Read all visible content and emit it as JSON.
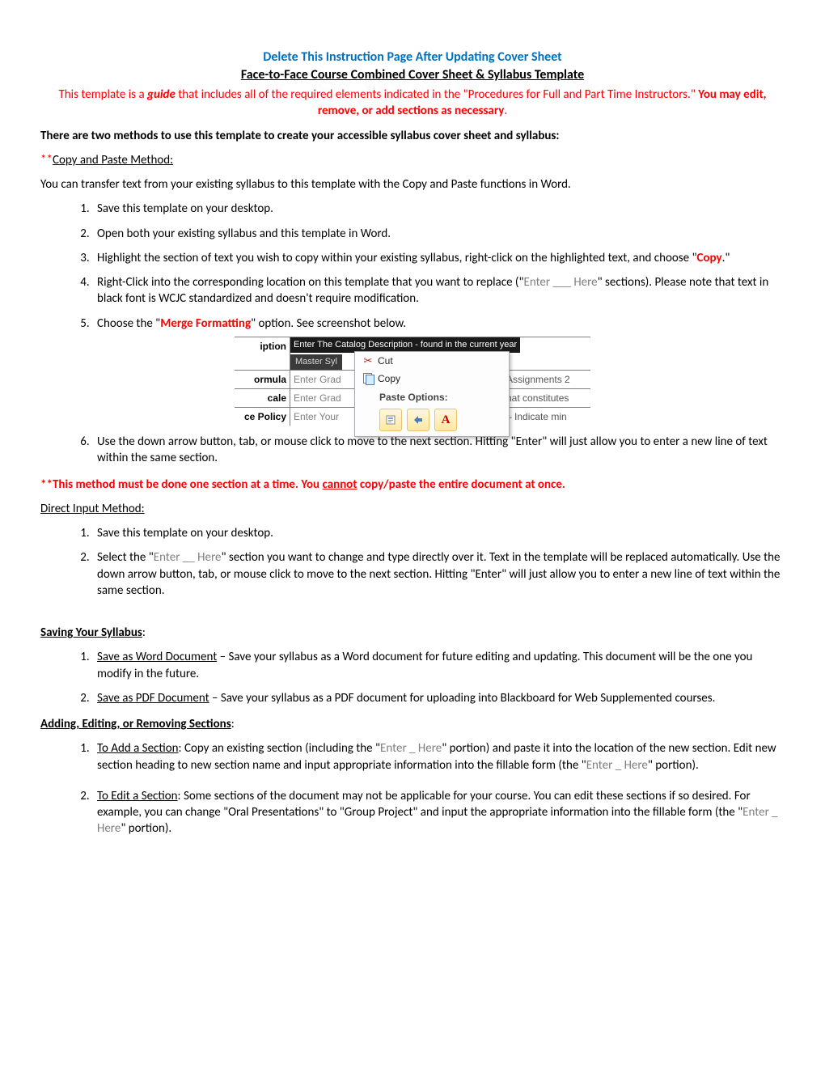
{
  "header": {
    "delete_notice": "Delete This Instruction Page After Updating Cover Sheet",
    "subtitle": "Face-to-Face Course Combined Cover Sheet & Syllabus Template",
    "guide_pre": "This template is a ",
    "guide_word": "guide",
    "guide_mid": " that includes all of the required elements indicated in the \"Procedures for Full and Part Time Instructors.\" ",
    "guide_bold_tail": "You may edit, remove, or add sections as necessary",
    "period": "."
  },
  "intro_bold": "There are two methods to use this template to create your accessible syllabus cover sheet and syllabus:",
  "method1": {
    "stars": "**",
    "title": "Copy and Paste Method:",
    "desc": "You can transfer text from your existing syllabus to this template with the Copy and Paste functions in Word.",
    "items": {
      "i1": "Save this template on your desktop.",
      "i2": "Open both your existing syllabus and this template in Word.",
      "i3_pre": "Highlight the section of text you wish to copy within your existing syllabus, right-click on the highlighted text, and choose \"",
      "i3_copy": "Copy",
      "i3_post": ".\"",
      "i4_pre": "Right-Click into the corresponding location on this template that you want to replace (\"",
      "i4_gray": "Enter ___ Here",
      "i4_post": "\" sections). Please note that text in black font is WCJC standardized and doesn't require modification.",
      "i5_pre": "Choose the \"",
      "i5_merge": "Merge Formatting",
      "i5_post": "\" option. See screenshot below.",
      "i6": "Use the down arrow button, tab, or mouse click to move to the next section. Hitting \"Enter\" will just allow you to enter a new line of text within the same section."
    }
  },
  "illus": {
    "row1_label": "iption",
    "row1_sel": "Enter The Catalog Description - found in the current year",
    "row1_master": "Master Syl",
    "row2_label": "ormula",
    "row2_mid": "Enter Grad",
    "row2_right": "Assignments 2",
    "row3_label": "cale",
    "row3_mid": "Enter Grad",
    "row3_right": "hat constitutes",
    "row4_label": "ce Policy",
    "row4_mid": "Enter Your",
    "row4_right": "– Indicate min",
    "ctx_cut": "Cut",
    "ctx_copy": "Copy",
    "ctx_paste_hdr": "Paste Options:",
    "ctx_a": "A"
  },
  "warning": {
    "pre": "**This method must be done one section at a time. You ",
    "cannot": "cannot",
    "post": " copy/paste the entire document at once."
  },
  "method2": {
    "title": "Direct Input Method:",
    "i1": "Save this template on your desktop.",
    "i2_pre": "Select the \"",
    "i2_gray": "Enter __ Here",
    "i2_post": "\" section you want to change and type directly over it. Text in the template will be replaced automatically. Use the down arrow button, tab, or mouse click to move to the next section. Hitting \"Enter\" will just allow you to enter a new line of text within the same section."
  },
  "saving": {
    "title": "Saving Your Syllabus",
    "colon": ":",
    "i1_label": "Save as Word Document",
    "i1_rest": " – Save your syllabus as a Word document for future editing and updating. This document will be the one you modify in the future.",
    "i2_label": "Save as PDF Document",
    "i2_rest": " – Save your syllabus as a PDF document for uploading into Blackboard for Web Supplemented courses."
  },
  "editing": {
    "title": "Adding, Editing, or Removing Sections",
    "colon": ":",
    "i1_label": "To Add a Section",
    "i1_pre": ": Copy an existing section (including the \"",
    "i1_gray": "Enter _ Here",
    "i1_mid": "\" portion) and paste it into the location of the new section. Edit new section heading to new section name and input appropriate information into the fillable form (the \"",
    "i1_gray2": "Enter _ Here",
    "i1_post": "\" portion).",
    "i2_label": "To Edit a Section",
    "i2_pre": ": Some sections of the document may not be applicable for your course. You can edit these sections if so desired. For example, you can change \"Oral Presentations\" to \"Group Project\" and input the appropriate information into the fillable form (the \"",
    "i2_gray": "Enter _ Here",
    "i2_post": "\" portion)."
  }
}
